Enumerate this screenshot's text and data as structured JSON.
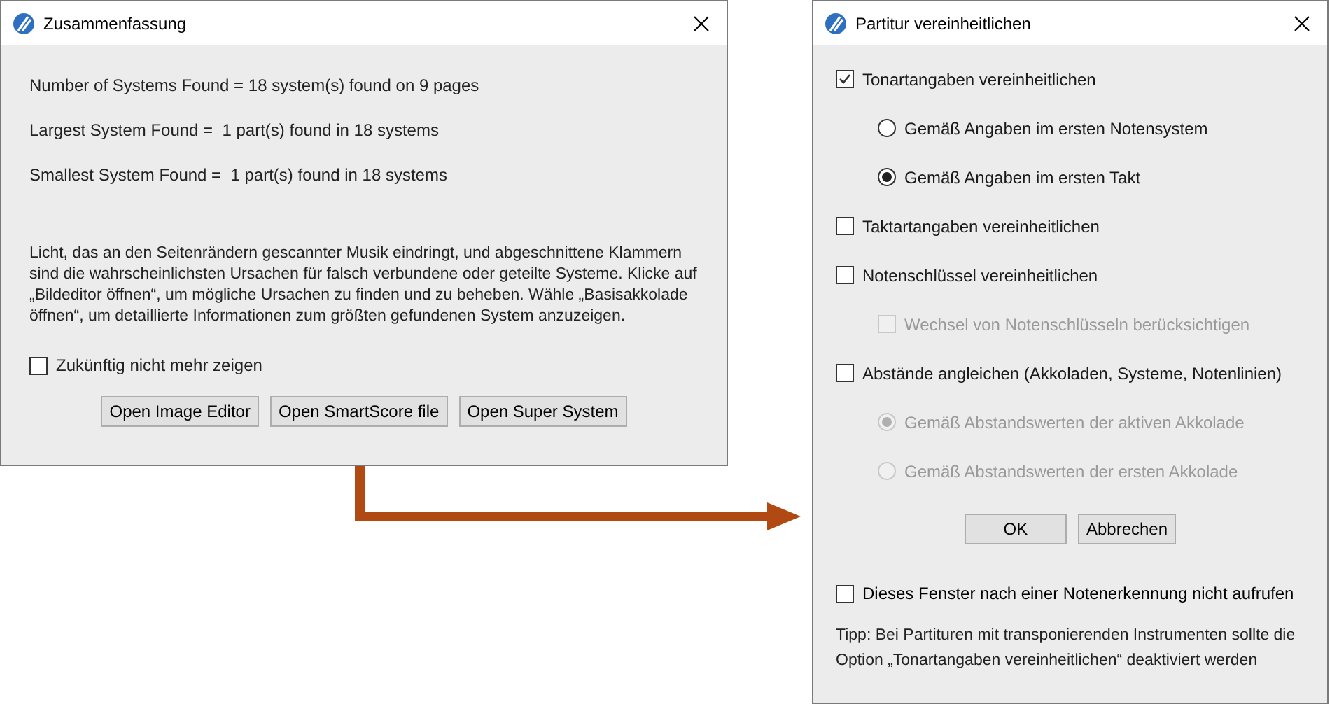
{
  "summary_window": {
    "title": "Zusammenfassung",
    "results": [
      "Number of Systems Found = 18 system(s) found on 9 pages",
      "Largest System Found =  1 part(s) found in 18 systems",
      "Smallest System Found =  1 part(s) found in 18 systems"
    ],
    "message": "Licht, das an den Seitenrändern gescannter Musik eindringt, und abgeschnittene Klammern sind die wahrscheinlichsten Ursachen für falsch verbundene oder geteilte Systeme. Klicke auf „Bildeditor öffnen“, um mögliche Ursachen zu finden und zu beheben. Wähle „Basisakkolade öffnen“, um detaillierte Informationen zum größten gefundenen System anzuzeigen.",
    "dont_show_again": {
      "label": "Zukünftig nicht mehr zeigen",
      "checked": false
    },
    "buttons": [
      "Open Image Editor",
      "Open SmartScore file",
      "Open Super System"
    ]
  },
  "unify_window": {
    "title": "Partitur vereinheitlichen",
    "options": [
      {
        "kind": "checkbox",
        "label": "Tonartangaben vereinheitlichen",
        "checked": true,
        "disabled": false,
        "children": [
          {
            "kind": "radio",
            "label": "Gemäß Angaben im ersten Notensystem",
            "selected": false,
            "disabled": false
          },
          {
            "kind": "radio",
            "label": "Gemäß Angaben im ersten Takt",
            "selected": true,
            "disabled": false
          }
        ]
      },
      {
        "kind": "checkbox",
        "label": "Taktartangaben vereinheitlichen",
        "checked": false,
        "disabled": false
      },
      {
        "kind": "checkbox",
        "label": "Notenschlüssel vereinheitlichen",
        "checked": false,
        "disabled": false,
        "children": [
          {
            "kind": "checkbox",
            "label": "Wechsel von Notenschlüsseln berücksichtigen",
            "checked": false,
            "disabled": true
          }
        ]
      },
      {
        "kind": "checkbox",
        "label": "Abstände angleichen (Akkoladen, Systeme, Notenlinien)",
        "checked": false,
        "disabled": false,
        "children": [
          {
            "kind": "radio",
            "label": "Gemäß Abstandswerten der aktiven Akkolade",
            "selected": true,
            "disabled": true
          },
          {
            "kind": "radio",
            "label": "Gemäß Abstandswerten der ersten Akkolade",
            "selected": false,
            "disabled": true
          }
        ]
      }
    ],
    "buttons": [
      "OK",
      "Abbrechen"
    ],
    "dont_open": {
      "label": "Dieses Fenster nach einer Notenerkennung nicht aufrufen",
      "checked": false
    },
    "tip": "Tipp: Bei Partituren mit transponierenden Instrumenten sollte die Option „Tonartangaben vereinheitlichen“ deaktiviert werden"
  }
}
